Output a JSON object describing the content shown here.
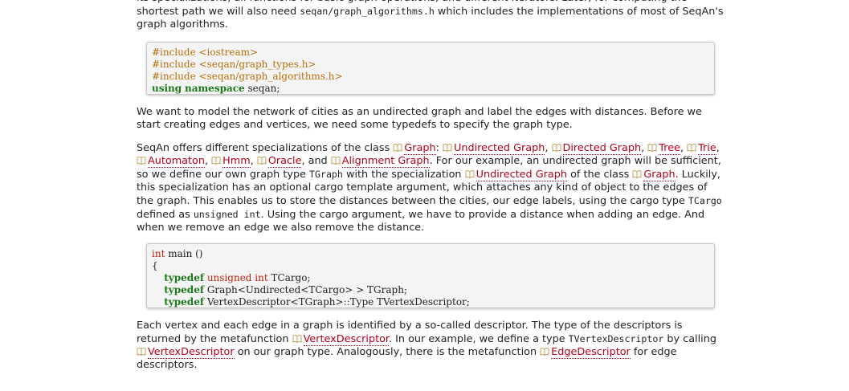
{
  "para0": {
    "t1": "its specializations, all functions for basic graph operations, and different iterators. Later, for computing the shortest path we will also need ",
    "code": "seqan/graph_algorithms.h",
    "t2": " which includes the implementations of most of SeqAn's graph algorithms."
  },
  "code_block_1": {
    "line1_directive": "#include <iostream>",
    "line2_directive": "#include <seqan/graph_types.h>",
    "line3_directive": "#include <seqan/graph_algorithms.h>",
    "line4_kw1": "using",
    "line4_kw2": "namespace",
    "line4_rest": " seqan;"
  },
  "para1": {
    "text": "We want to model the network of cities as an undirected graph and label the edges with distances. Before we start creating edges and vertices, we need some typedefs to specify the graph type."
  },
  "para2": {
    "t1": "SeqAn offers different specializations of the class ",
    "link_graph": "Graph",
    "t2": ": ",
    "link_undirected_graph": "Undirected Graph",
    "t3": ", ",
    "link_directed_graph": "Directed Graph",
    "t4": ", ",
    "link_tree": "Tree",
    "t5": ", ",
    "link_trie": "Trie",
    "t6": ", ",
    "link_automaton": "Automaton",
    "t7": ", ",
    "link_hmm": "Hmm",
    "t8": ", ",
    "link_oracle": "Oracle",
    "t9": ", and ",
    "link_alignment_graph": "Alignment Graph",
    "t10": ". For our example, an undirected graph will be sufficient, so we define our own graph type ",
    "code_tgraph": "TGraph",
    "t11": " with the specialization ",
    "link_undirected_graph_2": "Undirected Graph",
    "t12": " of the class ",
    "link_graph_2": "Graph",
    "t13": ". Luckily, this specialization has an optional cargo template argument, which attaches any kind of object to the edges of the graph. This enables us to store the distances between the cities, our edge labels, using the cargo type ",
    "code_tcargo": "TCargo",
    "t14": " defined as ",
    "code_unsigned_int": "unsigned int",
    "t15": ". Using the cargo argument, we have to provide a distance when adding an edge. And when we remove an edge we also remove the distance."
  },
  "code_block_2": {
    "l1_type": "int",
    "l1_rest": " main ()",
    "l2": "{",
    "l3_kw": "typedef",
    "l3_type": "unsigned int",
    "l3_rest": " TCargo;",
    "l4_kw": "typedef",
    "l4_rest": " Graph<Undirected<TCargo> > TGraph;",
    "l5_kw": "typedef",
    "l5_rest_a": " VertexDescriptor<TGraph>",
    "l5_colons": "::",
    "l5_rest_b": "Type TVertexDescriptor;"
  },
  "para3": {
    "t1": "Each vertex and each edge in a graph is identified by a so-called descriptor. The type of the descriptors is returned by the metafunction ",
    "link_vertex_descriptor": "VertexDescriptor",
    "t2": ". In our example, we define a type ",
    "code_tvertex": "TVertexDescriptor",
    "t3": " by calling ",
    "link_vertex_descriptor_2": "VertexDescriptor",
    "t4": " on our graph type. Analogously, there is the metafunction ",
    "link_edge_descriptor": "EdgeDescriptor",
    "t5": " for edge descriptors."
  },
  "icons": {
    "doc_link_icon": "open-book-icon"
  },
  "colors": {
    "link": "#b3001b",
    "keyword": "#1a7a1a",
    "preprocessor": "#b7700c",
    "type": "#b9240f",
    "code_bg": "#f4f4f4"
  }
}
